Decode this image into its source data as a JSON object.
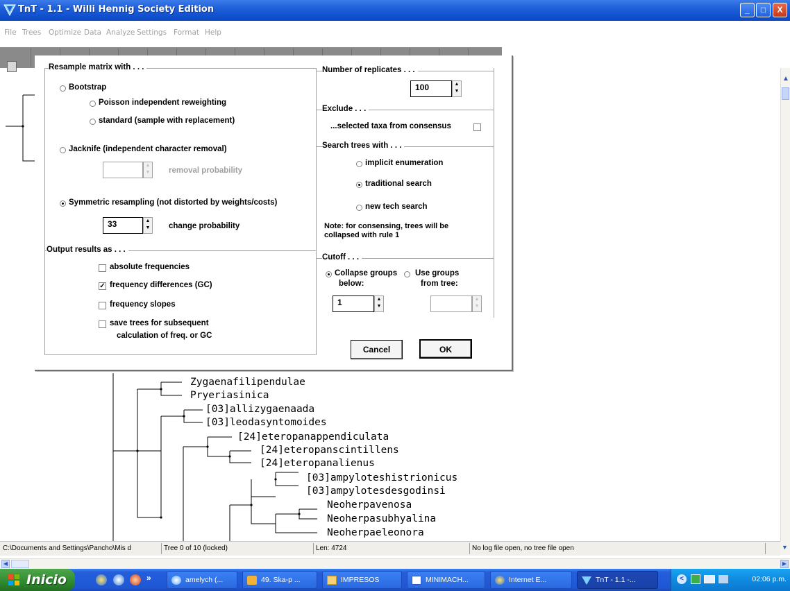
{
  "window": {
    "title": "TnT - 1.1 - Willi Hennig Society Edition",
    "controls": [
      "_",
      "□",
      "X"
    ]
  },
  "menu": [
    "File",
    "Trees",
    "Optimize",
    "Data",
    "Analyze",
    "Settings",
    "Format",
    "Help"
  ],
  "tree": {
    "taxa": [
      "Zygaenafilipendulae",
      "Pryeriasinica",
      "[03]allizygaenaada",
      "[03]leodasyntomoides",
      "[24]eteropanappendiculata",
      "[24]eteropanscintillens",
      "[24]eteropanalienus",
      "[03]ampyloteshistrionicus",
      "[03]ampylotesdesgodinsi",
      "Neoherpavenosa",
      "Neoherpasubhyalina",
      "Neoherpaeleonora"
    ]
  },
  "dialog": {
    "resample_group": "Resample matrix with . . .",
    "bootstrap": "Bootstrap",
    "poisson": "Poisson independent reweighting",
    "standard": "standard (sample with replacement)",
    "jacknife": "Jacknife (independent character removal)",
    "removal_prob_label": "removal probability",
    "removal_prob_value": "",
    "symmetric": "Symmetric resampling (not distorted by weights/costs)",
    "change_prob_value": "33",
    "change_prob_label": "change probability",
    "output_group": "Output results as . . .",
    "abs_freq": "absolute frequencies",
    "freq_diff": "frequency differences (GC)",
    "freq_slopes": "frequency slopes",
    "save_trees_1": "save trees for subsequent",
    "save_trees_2": "calculation of freq. or GC",
    "replicates_group": "Number of replicates . . .",
    "replicates_value": "100",
    "exclude_group": "Exclude . . .",
    "exclude_text": "...selected taxa from consensus",
    "search_group": "Search trees with . . .",
    "implicit": "implicit enumeration",
    "traditional": "traditional search",
    "newtech": "new tech search",
    "note_1": "Note: for consensing, trees will be",
    "note_2": "collapsed with rule 1",
    "cutoff_group": "Cutoff . . .",
    "collapse_1": "Collapse groups",
    "collapse_2": "below:",
    "collapse_value": "1",
    "usegroups_1": "Use groups",
    "usegroups_2": "from tree:",
    "usegroups_value": "",
    "cancel": "Cancel",
    "ok": "OK",
    "selected": {
      "resample": "Symmetric",
      "bootstrap_sub": "none",
      "search": "traditional search",
      "cutoff": "Collapse groups",
      "freq_diff_checked": true,
      "abs_freq_checked": false,
      "freq_slopes_checked": false,
      "save_trees_checked": false,
      "exclude_checked": false
    }
  },
  "status": {
    "path": "C:\\Documents and Settings\\Pancho\\Mis d",
    "tree": "Tree 0 of 10 (locked)",
    "len": "Len: 4724",
    "log": "No log file open, no tree file open"
  },
  "taskbar": {
    "start": "Inicio",
    "chevron": "»",
    "tasks": [
      "amelych (...",
      "49. Ska-p ...",
      "IMPRESOS",
      "MINIMACH...",
      "Internet E...",
      "TnT - 1.1 -..."
    ],
    "clock": "02:06 p.m."
  },
  "colors": {
    "titlebar": "#0a48c7",
    "taskbar": "#245edb",
    "start": "#2e8a2e",
    "tray": "#0f8ae0"
  }
}
